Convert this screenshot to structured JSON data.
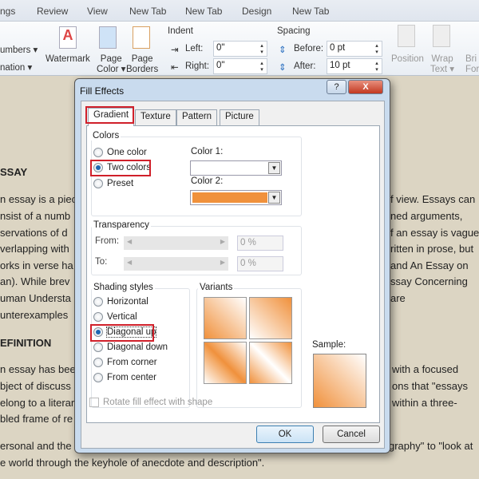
{
  "ribbon_tabs": [
    "ngs",
    "Review",
    "View",
    "New Tab",
    "New Tab",
    "Design",
    "New Tab"
  ],
  "ribbon": {
    "numbers": "umbers ▾",
    "nation": "nation ▾",
    "watermark": "Watermark",
    "page_color": [
      "Page",
      "Color ▾"
    ],
    "page_borders": [
      "Page",
      "Borders"
    ],
    "indent_label": "Indent",
    "left_label": "Left:",
    "left_value": "0\"",
    "right_label": "Right:",
    "right_value": "0\"",
    "spacing_label": "Spacing",
    "before_label": "Before:",
    "before_value": "0 pt",
    "after_label": "After:",
    "after_value": "10 pt",
    "position": "Position",
    "wrap_text": [
      "Wrap",
      "Text ▾"
    ],
    "bring_forward": [
      "Bri",
      "Forw"
    ]
  },
  "document": {
    "heading1": "SSAY",
    "heading2": "EFINITION",
    "left_lines": [
      "n essay is a piece",
      "nsist of a numb",
      "servations of d",
      "verlapping with",
      "orks in verse ha",
      "an). While brev",
      "uman Understa",
      "unterexamples"
    ],
    "right_lines": [
      "f view. Essays can",
      "ned arguments,",
      "f an essay is vague,",
      "ritten in prose, but",
      "and An Essay on",
      "ssay Concerning",
      "are",
      ""
    ],
    "left_lines2": [
      "n essay has bee",
      "bject of discuss",
      "elong to a literar",
      "bled frame of re"
    ],
    "right_lines2": [
      "with a focused",
      "ons that \"essays",
      "within a three-",
      ""
    ],
    "last_left": "ersonal and the",
    "last_right": "graphy\" to \"look at",
    "final_line": "e world through the keyhole of anecdote and description\"."
  },
  "dialog": {
    "title": "Fill Effects",
    "help": "?",
    "close": "X",
    "tabs": [
      "Gradient",
      "Texture",
      "Pattern",
      "Picture"
    ],
    "active_tab": "Gradient",
    "colors_group": "Colors",
    "color_options": [
      "One color",
      "Two colors",
      "Preset"
    ],
    "selected_color_option": "Two colors",
    "color1_label": "Color 1:",
    "color2_label": "Color 2:",
    "color1": "#ffffff",
    "color2": "#f0913c",
    "transparency_group": "Transparency",
    "from_label": "From:",
    "to_label": "To:",
    "from_value": "0 %",
    "to_value": "0 %",
    "shading_group": "Shading styles",
    "shading_options": [
      "Horizontal",
      "Vertical",
      "Diagonal up",
      "Diagonal down",
      "From corner",
      "From center"
    ],
    "selected_shading": "Diagonal up",
    "variants_label": "Variants",
    "sample_label": "Sample:",
    "rotate_label": "Rotate fill effect with shape",
    "ok": "OK",
    "cancel": "Cancel"
  },
  "highlight_color": "#d0202a"
}
